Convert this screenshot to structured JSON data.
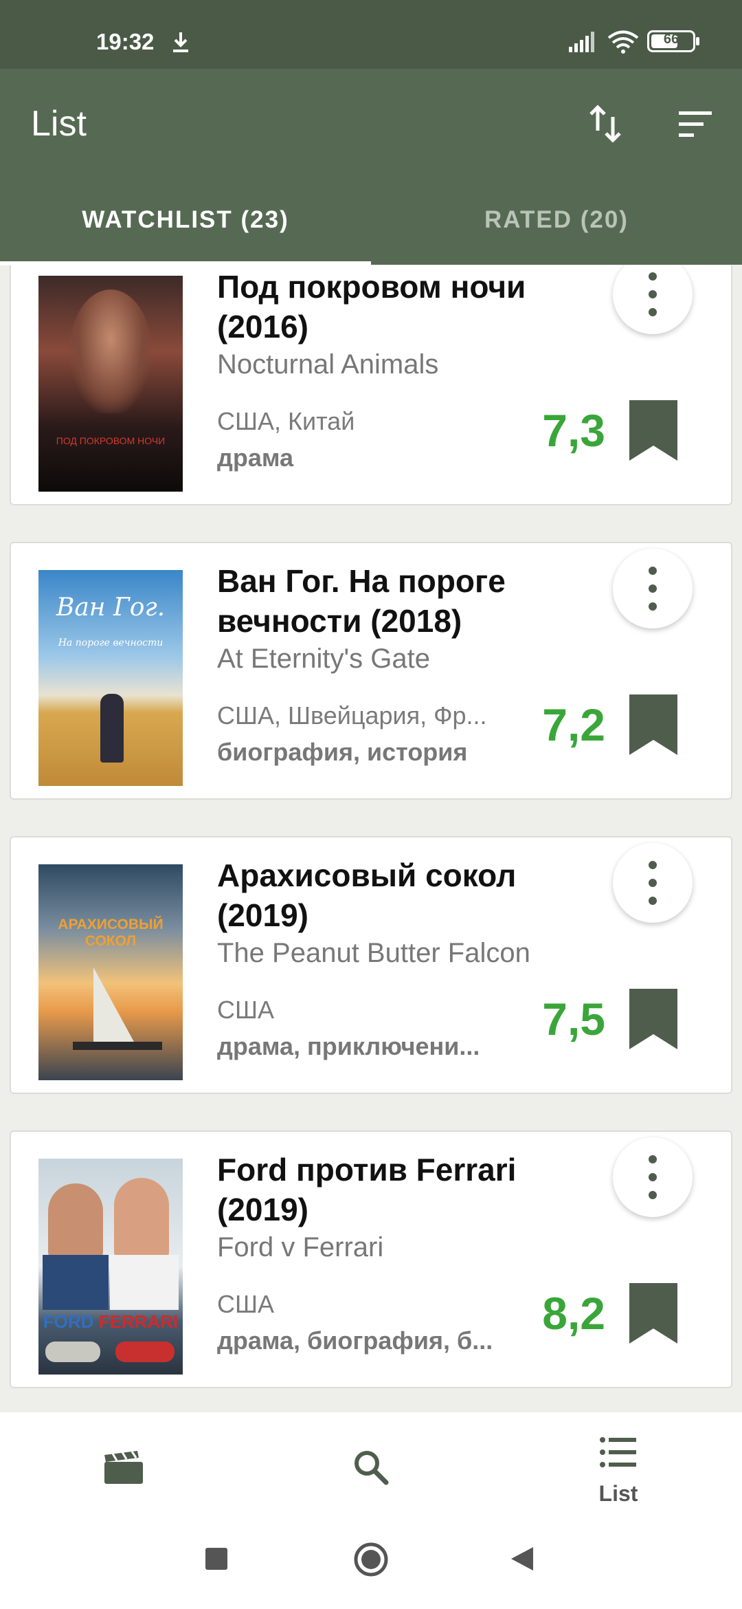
{
  "status_bar": {
    "time": "19:32",
    "battery": "66"
  },
  "app_bar": {
    "title": "List"
  },
  "tabs": [
    {
      "label": "WATCHLIST (23)",
      "selected": true
    },
    {
      "label": "RATED (20)",
      "selected": false
    }
  ],
  "movies": [
    {
      "title": "Под покровом ночи (2016)",
      "original_title": "Nocturnal Animals",
      "countries": "США, Китай",
      "genres": "драма",
      "rating": "7,3",
      "poster_text": "ПОД ПОКРОВОМ НОЧИ"
    },
    {
      "title": "Ван Гог. На пороге вечности (2018)",
      "original_title": "At Eternity's Gate",
      "countries": "США, Швейцария, Фр...",
      "genres": "биография, история",
      "rating": "7,2",
      "poster_text": "Ван Гог.",
      "poster_subtext": "На пороге вечности"
    },
    {
      "title": "Арахисовый сокол (2019)",
      "original_title": "The Peanut Butter Falcon",
      "countries": "США",
      "genres": "драма, приключени...",
      "rating": "7,5",
      "poster_text": "АРАХИСОВЫЙ",
      "poster_subtext": "СОКОЛ"
    },
    {
      "title": "Ford против Ferrari (2019)",
      "original_title": "Ford v Ferrari",
      "countries": "США",
      "genres": "драма, биография, б...",
      "rating": "8,2",
      "poster_text": "FORD",
      "poster_subtext": "FERRARI"
    }
  ],
  "bottom_nav": [
    {
      "icon": "clapperboard-icon",
      "label": ""
    },
    {
      "icon": "search-icon",
      "label": ""
    },
    {
      "icon": "list-icon",
      "label": "List",
      "selected": true
    }
  ],
  "colors": {
    "primary": "#566a53",
    "status_bar": "#4a5a47",
    "rating_green": "#3aa63a",
    "bookmark": "#4f5d4d"
  }
}
